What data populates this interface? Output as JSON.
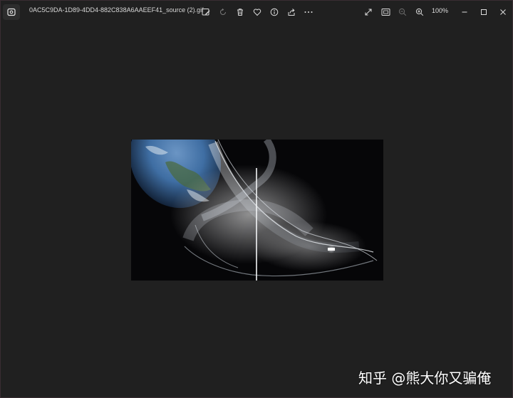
{
  "titlebar": {
    "filename": "0AC5C9DA-1D89-4DD4-882C838A6AAEEF41_source (2).gif",
    "zoom_level": "100%"
  },
  "toolbar": {
    "icons": [
      "edit-image-icon",
      "rotate-icon",
      "delete-icon",
      "favorite-icon",
      "info-icon",
      "share-icon",
      "more-icon"
    ]
  },
  "view_controls": {
    "icons": [
      "fullscreen-icon",
      "fit-to-window-icon",
      "zoom-out-icon",
      "zoom-in-icon"
    ]
  },
  "window_controls": {
    "icons": [
      "minimize-icon",
      "maximize-icon",
      "close-icon"
    ]
  },
  "image": {
    "description_colors": {
      "background": "#060608",
      "earth_blue": "#3f6ea3",
      "glow": "#dfe4ea"
    }
  },
  "watermark": {
    "text": "知乎 @熊大你又骗俺"
  }
}
